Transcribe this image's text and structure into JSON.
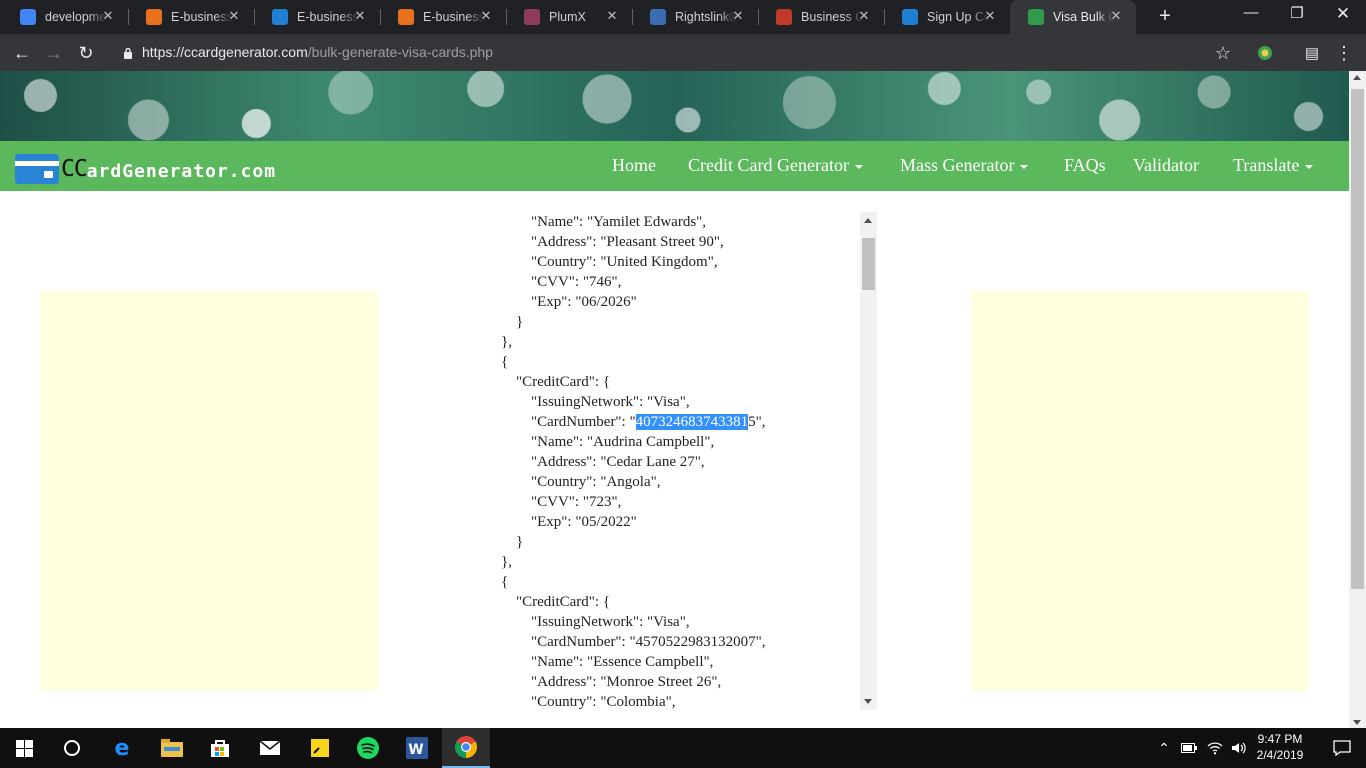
{
  "browser": {
    "tabs": [
      {
        "title": "development",
        "favicon": "google-scholar-icon",
        "color": "#4285f4"
      },
      {
        "title": "E-business",
        "favicon": "elsevier-icon",
        "color": "#e9711c"
      },
      {
        "title": "E-business",
        "favicon": "edge-icon",
        "color": "#1f7fd1"
      },
      {
        "title": "E-business",
        "favicon": "elsevier-icon",
        "color": "#e9711c"
      },
      {
        "title": "PlumX",
        "favicon": "plumx-icon",
        "color": "#8e3a59"
      },
      {
        "title": "Rightslink®",
        "favicon": "rightslink-icon",
        "color": "#3b6eb0"
      },
      {
        "title": "Business Co",
        "favicon": "book-icon",
        "color": "#c0392b"
      },
      {
        "title": "Sign Up Co",
        "favicon": "edge-icon",
        "color": "#1f7fd1"
      },
      {
        "title": "Visa Bulk Cr",
        "favicon": "card-icon",
        "color": "#2e9c4a"
      }
    ],
    "active_tab": 8,
    "url_domain": "https://ccardgenerator.com",
    "url_path": "/bulk-generate-visa-cards.php"
  },
  "site": {
    "logo_cc": "CC",
    "logo_rest": "ardGenerator.com",
    "nav": [
      "Home",
      "Credit Card Generator",
      "Mass Generator",
      "FAQs",
      "Validator",
      "Translate"
    ]
  },
  "code": {
    "lines_before": "        \"Name\": \"Yamilet Edwards\",\n        \"Address\": \"Pleasant Street 90\",\n        \"Country\": \"United Kingdom\",\n        \"CVV\": \"746\",\n        \"Exp\": \"06/2026\"\n    }\n},\n{\n    \"CreditCard\": {\n        \"IssuingNetwork\": \"Visa\",\n        \"CardNumber\": \"",
    "highlighted": "407324683743381",
    "lines_after": "5\",\n        \"Name\": \"Audrina Campbell\",\n        \"Address\": \"Cedar Lane 27\",\n        \"Country\": \"Angola\",\n        \"CVV\": \"723\",\n        \"Exp\": \"05/2022\"\n    }\n},\n{\n    \"CreditCard\": {\n        \"IssuingNetwork\": \"Visa\",\n        \"CardNumber\": \"4570522983132007\",\n        \"Name\": \"Essence Campbell\",\n        \"Address\": \"Monroe Street 26\",\n        \"Country\": \"Colombia\","
  },
  "taskbar": {
    "time": "9:47 PM",
    "date": "2/4/2019"
  }
}
